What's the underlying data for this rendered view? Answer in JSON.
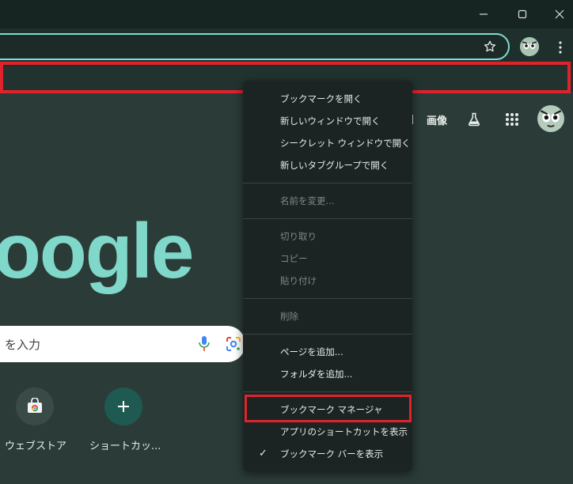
{
  "ntp": {
    "images_label": "画像",
    "logo_text": "oogle",
    "search_placeholder": "を入力",
    "shortcuts": [
      {
        "label": "ウェブストア"
      },
      {
        "label": "ショートカッ..."
      }
    ],
    "add_icon": "plus-icon"
  },
  "context_menu": {
    "items": [
      {
        "label": "ブックマークを開く",
        "enabled": true
      },
      {
        "label": "新しいウィンドウで開く",
        "enabled": true
      },
      {
        "label": "シークレット ウィンドウで開く",
        "enabled": true
      },
      {
        "label": "新しいタブグループで開く",
        "enabled": true
      },
      {
        "label": "名前を変更...",
        "enabled": false
      },
      {
        "label": "切り取り",
        "enabled": false
      },
      {
        "label": "コピー",
        "enabled": false
      },
      {
        "label": "貼り付け",
        "enabled": false
      },
      {
        "label": "削除",
        "enabled": false
      },
      {
        "label": "ページを追加...",
        "enabled": true
      },
      {
        "label": "フォルダを追加...",
        "enabled": true
      },
      {
        "label": "ブックマーク マネージャ",
        "enabled": true,
        "highlighted": true
      },
      {
        "label": "アプリのショートカットを表示",
        "enabled": true
      },
      {
        "label": "ブックマーク バーを表示",
        "enabled": true,
        "checked": true
      }
    ]
  },
  "colors": {
    "highlight_border": "#e0232b",
    "accent": "#7fd8c9",
    "background": "#2b3c38"
  }
}
